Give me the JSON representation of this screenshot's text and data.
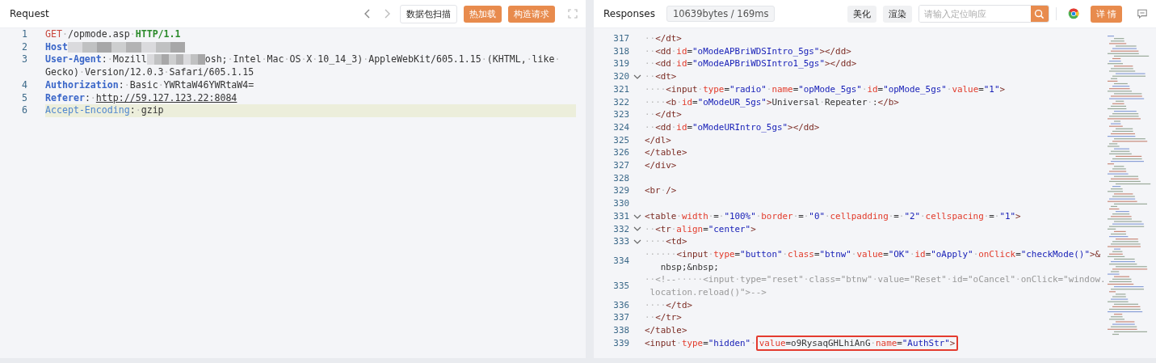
{
  "request": {
    "title": "Request",
    "buttons": [
      {
        "label": "数据包扫描",
        "kind": "outline"
      },
      {
        "label": "热加载",
        "kind": "primary"
      },
      {
        "label": "构造请求",
        "kind": "primary"
      }
    ],
    "lines": [
      {
        "number": "1",
        "current": false,
        "rows": [
          [
            {
              "kind": "method",
              "text": "GET"
            },
            {
              "kind": "plain",
              "text": "·/opmode.asp·"
            },
            {
              "kind": "version",
              "text": "HTTP/1.1"
            }
          ]
        ]
      },
      {
        "number": "2",
        "current": false,
        "rows": [
          [
            {
              "kind": "key",
              "text": "Host"
            },
            {
              "kind": "mosaic"
            }
          ]
        ]
      },
      {
        "number": "3",
        "current": false,
        "rows": [
          [
            {
              "kind": "key",
              "text": "User-Agent"
            },
            {
              "kind": "plain",
              "text": ":·Mozill"
            },
            {
              "kind": "mosaic-short"
            },
            {
              "kind": "plain",
              "text": "osh;·Intel·Mac·OS·X·10_14_3)·AppleWebKit/605.1.15·(KHTML,·like·"
            }
          ],
          [
            {
              "kind": "plain",
              "text": "Gecko)·Version/12.0.3·Safari/605.1.15"
            }
          ]
        ]
      },
      {
        "number": "4",
        "current": false,
        "rows": [
          [
            {
              "kind": "key",
              "text": "Authorization"
            },
            {
              "kind": "plain",
              "text": ":·Basic·YWRtaW46YWRtaW4="
            }
          ]
        ]
      },
      {
        "number": "5",
        "current": false,
        "rows": [
          [
            {
              "kind": "key",
              "text": "Referer"
            },
            {
              "kind": "plain",
              "text": ":·"
            },
            {
              "kind": "link",
              "text": "http://59.127.123.22:8084"
            }
          ]
        ]
      },
      {
        "number": "6",
        "current": true,
        "rows": [
          [
            {
              "kind": "key-light",
              "text": "Accept-Encoding"
            },
            {
              "kind": "plain",
              "text": ":·gzip"
            }
          ]
        ]
      }
    ]
  },
  "response": {
    "title": "Responses",
    "stats": "10639bytes / 169ms",
    "tabs": [
      {
        "label": "美化"
      },
      {
        "label": "渲染"
      }
    ],
    "search": {
      "placeholder": "请输入定位响应"
    },
    "detail_button": "详 情",
    "lines": [
      {
        "number": "317",
        "fold": false,
        "rows": [
          [
            {
              "kind": "ws",
              "text": "··"
            },
            {
              "kind": "tag",
              "text": "</dt>"
            }
          ]
        ]
      },
      {
        "number": "318",
        "fold": false,
        "rows": [
          [
            {
              "kind": "ws",
              "text": "··"
            },
            {
              "kind": "tag",
              "text": "<dd"
            },
            {
              "kind": "plain",
              "text": "·"
            },
            {
              "kind": "attr",
              "text": "id"
            },
            {
              "kind": "plain",
              "text": "="
            },
            {
              "kind": "string",
              "text": "\"oModeAPBriWDSIntro_5gs\""
            },
            {
              "kind": "tag",
              "text": "></dd>"
            }
          ]
        ]
      },
      {
        "number": "319",
        "fold": false,
        "rows": [
          [
            {
              "kind": "ws",
              "text": "··"
            },
            {
              "kind": "tag",
              "text": "<dd"
            },
            {
              "kind": "plain",
              "text": "·"
            },
            {
              "kind": "attr",
              "text": "id"
            },
            {
              "kind": "plain",
              "text": "="
            },
            {
              "kind": "string",
              "text": "\"oModeAPBriWDSIntro1_5gs\""
            },
            {
              "kind": "tag",
              "text": "></dd>"
            }
          ]
        ]
      },
      {
        "number": "320",
        "fold": true,
        "rows": [
          [
            {
              "kind": "ws",
              "text": "··"
            },
            {
              "kind": "tag",
              "text": "<dt>"
            }
          ]
        ]
      },
      {
        "number": "321",
        "fold": false,
        "rows": [
          [
            {
              "kind": "ws",
              "text": "····"
            },
            {
              "kind": "tag",
              "text": "<input"
            },
            {
              "kind": "plain",
              "text": "·"
            },
            {
              "kind": "attr",
              "text": "type"
            },
            {
              "kind": "plain",
              "text": "="
            },
            {
              "kind": "string",
              "text": "\"radio\""
            },
            {
              "kind": "plain",
              "text": "·"
            },
            {
              "kind": "attr",
              "text": "name"
            },
            {
              "kind": "plain",
              "text": "="
            },
            {
              "kind": "string",
              "text": "\"opMode_5gs\""
            },
            {
              "kind": "plain",
              "text": "·"
            },
            {
              "kind": "attr",
              "text": "id"
            },
            {
              "kind": "plain",
              "text": "="
            },
            {
              "kind": "string",
              "text": "\"opMode_5gs\""
            },
            {
              "kind": "plain",
              "text": "·"
            },
            {
              "kind": "attr",
              "text": "value"
            },
            {
              "kind": "plain",
              "text": "="
            },
            {
              "kind": "string",
              "text": "\"1\""
            },
            {
              "kind": "tag",
              "text": ">"
            }
          ]
        ]
      },
      {
        "number": "322",
        "fold": false,
        "rows": [
          [
            {
              "kind": "ws",
              "text": "····"
            },
            {
              "kind": "tag",
              "text": "<b"
            },
            {
              "kind": "plain",
              "text": "·"
            },
            {
              "kind": "attr",
              "text": "id"
            },
            {
              "kind": "plain",
              "text": "="
            },
            {
              "kind": "string",
              "text": "\"oModeUR_5gs\""
            },
            {
              "kind": "tag",
              "text": ">"
            },
            {
              "kind": "plain",
              "text": "Universal·Repeater·:"
            },
            {
              "kind": "tag",
              "text": "</b>"
            }
          ]
        ]
      },
      {
        "number": "323",
        "fold": false,
        "rows": [
          [
            {
              "kind": "ws",
              "text": "··"
            },
            {
              "kind": "tag",
              "text": "</dt>"
            }
          ]
        ]
      },
      {
        "number": "324",
        "fold": false,
        "rows": [
          [
            {
              "kind": "ws",
              "text": "··"
            },
            {
              "kind": "tag",
              "text": "<dd"
            },
            {
              "kind": "plain",
              "text": "·"
            },
            {
              "kind": "attr",
              "text": "id"
            },
            {
              "kind": "plain",
              "text": "="
            },
            {
              "kind": "string",
              "text": "\"oModeURIntro_5gs\""
            },
            {
              "kind": "tag",
              "text": "></dd>"
            }
          ]
        ]
      },
      {
        "number": "325",
        "fold": false,
        "rows": [
          [
            {
              "kind": "tag",
              "text": "</dl>"
            }
          ]
        ]
      },
      {
        "number": "326",
        "fold": false,
        "rows": [
          [
            {
              "kind": "tag",
              "text": "</table>"
            }
          ]
        ]
      },
      {
        "number": "327",
        "fold": false,
        "rows": [
          [
            {
              "kind": "tag",
              "text": "</div>"
            }
          ]
        ]
      },
      {
        "number": "328",
        "fold": false,
        "rows": [
          []
        ]
      },
      {
        "number": "329",
        "fold": false,
        "rows": [
          [
            {
              "kind": "tag",
              "text": "<br"
            },
            {
              "kind": "plain",
              "text": "·"
            },
            {
              "kind": "tag",
              "text": "/>"
            }
          ]
        ]
      },
      {
        "number": "330",
        "fold": false,
        "rows": [
          []
        ]
      },
      {
        "number": "331",
        "fold": true,
        "rows": [
          [
            {
              "kind": "tag",
              "text": "<table"
            },
            {
              "kind": "plain",
              "text": "·"
            },
            {
              "kind": "attr",
              "text": "width"
            },
            {
              "kind": "plain",
              "text": "·=·"
            },
            {
              "kind": "string",
              "text": "\"100%\""
            },
            {
              "kind": "plain",
              "text": "·"
            },
            {
              "kind": "attr",
              "text": "border"
            },
            {
              "kind": "plain",
              "text": "·=·"
            },
            {
              "kind": "string",
              "text": "\"0\""
            },
            {
              "kind": "plain",
              "text": "·"
            },
            {
              "kind": "attr",
              "text": "cellpadding"
            },
            {
              "kind": "plain",
              "text": "·=·"
            },
            {
              "kind": "string",
              "text": "\"2\""
            },
            {
              "kind": "plain",
              "text": "·"
            },
            {
              "kind": "attr",
              "text": "cellspacing"
            },
            {
              "kind": "plain",
              "text": "·=·"
            },
            {
              "kind": "string",
              "text": "\"1\""
            },
            {
              "kind": "tag",
              "text": ">"
            }
          ]
        ]
      },
      {
        "number": "332",
        "fold": true,
        "rows": [
          [
            {
              "kind": "ws",
              "text": "··"
            },
            {
              "kind": "tag",
              "text": "<tr"
            },
            {
              "kind": "plain",
              "text": "·"
            },
            {
              "kind": "attr",
              "text": "align"
            },
            {
              "kind": "plain",
              "text": "="
            },
            {
              "kind": "string",
              "text": "\"center\""
            },
            {
              "kind": "tag",
              "text": ">"
            }
          ]
        ]
      },
      {
        "number": "333",
        "fold": true,
        "rows": [
          [
            {
              "kind": "ws",
              "text": "····"
            },
            {
              "kind": "tag",
              "text": "<td>"
            }
          ]
        ]
      },
      {
        "number": "334",
        "fold": false,
        "rows": [
          [
            {
              "kind": "ws",
              "text": "······"
            },
            {
              "kind": "tag",
              "text": "<input"
            },
            {
              "kind": "plain",
              "text": "·"
            },
            {
              "kind": "attr",
              "text": "type"
            },
            {
              "kind": "plain",
              "text": "="
            },
            {
              "kind": "string",
              "text": "\"button\""
            },
            {
              "kind": "plain",
              "text": "·"
            },
            {
              "kind": "attr",
              "text": "class"
            },
            {
              "kind": "plain",
              "text": "="
            },
            {
              "kind": "string",
              "text": "\"btnw\""
            },
            {
              "kind": "plain",
              "text": "·"
            },
            {
              "kind": "attr",
              "text": "value"
            },
            {
              "kind": "plain",
              "text": "="
            },
            {
              "kind": "string",
              "text": "\"OK\""
            },
            {
              "kind": "plain",
              "text": "·"
            },
            {
              "kind": "attr",
              "text": "id"
            },
            {
              "kind": "plain",
              "text": "="
            },
            {
              "kind": "string",
              "text": "\"oApply\""
            },
            {
              "kind": "plain",
              "text": "·"
            },
            {
              "kind": "attr",
              "text": "onClick"
            },
            {
              "kind": "plain",
              "text": "="
            },
            {
              "kind": "string",
              "text": "\"checkMode()\""
            },
            {
              "kind": "tag",
              "text": ">&"
            }
          ],
          [
            {
              "kind": "plain",
              "text": "nbsp;&nbsp;"
            }
          ]
        ]
      },
      {
        "number": "335",
        "fold": false,
        "rows": [
          [
            {
              "kind": "ws",
              "text": "··"
            },
            {
              "kind": "comment",
              "text": "<!--·····<input·type=\"reset\"·class=\"btnw\"·value=\"Reset\"·id=\"oCancel\"·onClick=\"window."
            }
          ],
          [
            {
              "kind": "comment",
              "text": "location.reload()\">-->"
            }
          ]
        ]
      },
      {
        "number": "336",
        "fold": false,
        "rows": [
          [
            {
              "kind": "ws",
              "text": "····"
            },
            {
              "kind": "tag",
              "text": "</td>"
            }
          ]
        ]
      },
      {
        "number": "337",
        "fold": false,
        "rows": [
          [
            {
              "kind": "ws",
              "text": "··"
            },
            {
              "kind": "tag",
              "text": "</tr>"
            }
          ]
        ]
      },
      {
        "number": "338",
        "fold": false,
        "rows": [
          [
            {
              "kind": "tag",
              "text": "</table>"
            }
          ]
        ]
      },
      {
        "number": "339",
        "fold": false,
        "rows": [
          [
            {
              "kind": "tag",
              "text": "<input"
            },
            {
              "kind": "plain",
              "text": "·"
            },
            {
              "kind": "attr",
              "text": "type"
            },
            {
              "kind": "plain",
              "text": "="
            },
            {
              "kind": "string",
              "text": "\"hidden\""
            },
            {
              "kind": "plain",
              "text": "·"
            },
            {
              "kind": "box",
              "children": [
                {
                  "kind": "attr",
                  "text": "value"
                },
                {
                  "kind": "plain",
                  "text": "=o9RysaqGHLhiAnG·"
                },
                {
                  "kind": "attr",
                  "text": "name"
                },
                {
                  "kind": "plain",
                  "text": "="
                },
                {
                  "kind": "string",
                  "text": "\"AuthStr\""
                },
                {
                  "kind": "tag",
                  "text": ">"
                }
              ]
            }
          ]
        ]
      }
    ]
  }
}
